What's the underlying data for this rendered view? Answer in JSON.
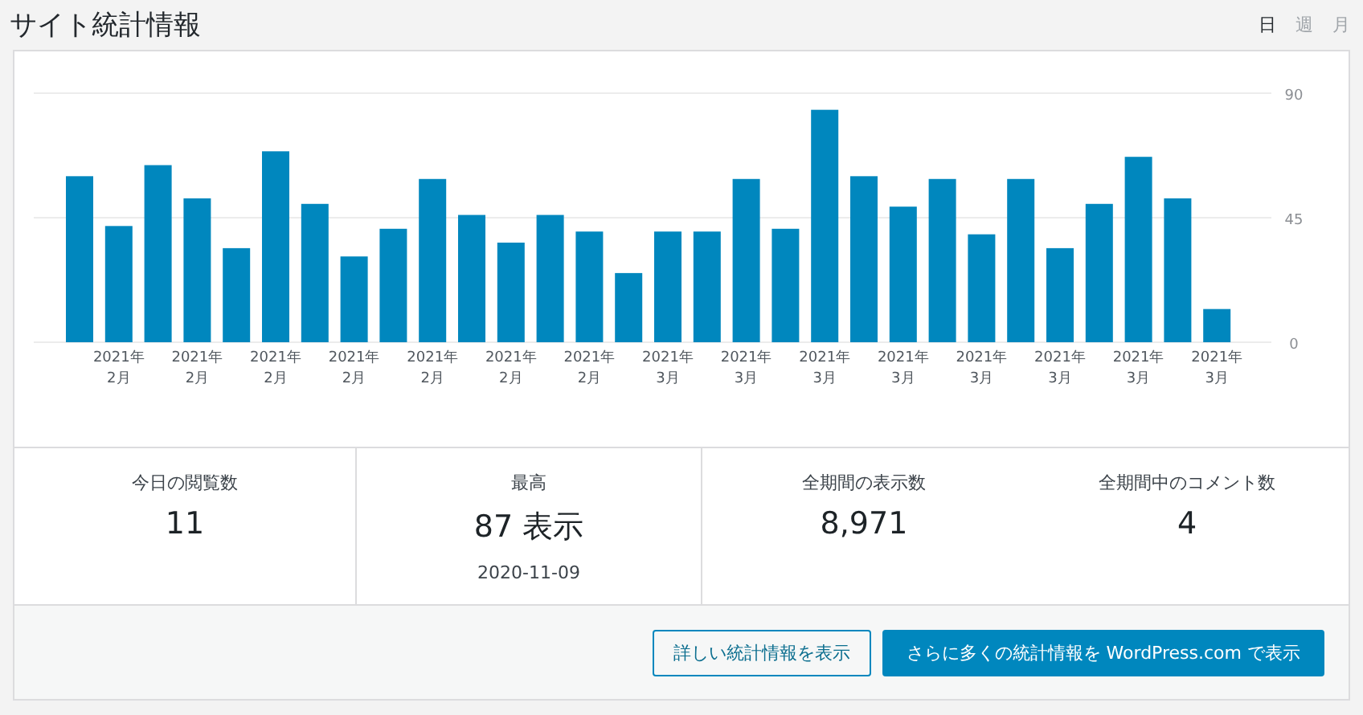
{
  "title": "サイト統計情報",
  "period_tabs": [
    {
      "label": "日",
      "selected": true
    },
    {
      "label": "週",
      "selected": false
    },
    {
      "label": "月",
      "selected": false
    }
  ],
  "chart_data": {
    "type": "bar",
    "categories": [
      null,
      "2021年 2月",
      null,
      "2021年 2月",
      null,
      "2021年 2月",
      null,
      "2021年 2月",
      null,
      "2021年 2月",
      null,
      "2021年 2月",
      null,
      "2021年 2月",
      null,
      "2021年 3月",
      null,
      "2021年 3月",
      null,
      "2021年 3月",
      null,
      "2021年 3月",
      null,
      "2021年 3月",
      null,
      "2021年 3月",
      null,
      "2021年 3月",
      null,
      "2021年 3月"
    ],
    "series": [
      {
        "color": "#0087be",
        "values": [
          60,
          42,
          64,
          52,
          34,
          69,
          50,
          31,
          41,
          59,
          46,
          36,
          46,
          40,
          25,
          40,
          40,
          59,
          41,
          84,
          60,
          49,
          59,
          39,
          59,
          34,
          50,
          67,
          52,
          12
        ]
      }
    ],
    "ylim": [
      0,
      90
    ],
    "yticks": [
      0,
      45,
      90
    ]
  },
  "stats": [
    {
      "label": "今日の閲覧数",
      "value": "11"
    },
    {
      "label": "最高",
      "value": "87 表示",
      "date": "2020-11-09"
    },
    {
      "label": "全期間の表示数",
      "value": "8,971"
    },
    {
      "label": "全期間中のコメント数",
      "value": "4"
    }
  ],
  "buttons": [
    {
      "label": "詳しい統計情報を表示",
      "kind": "secondary"
    },
    {
      "label": "さらに多くの統計情報を WordPress.com で表示",
      "kind": "primary"
    }
  ]
}
